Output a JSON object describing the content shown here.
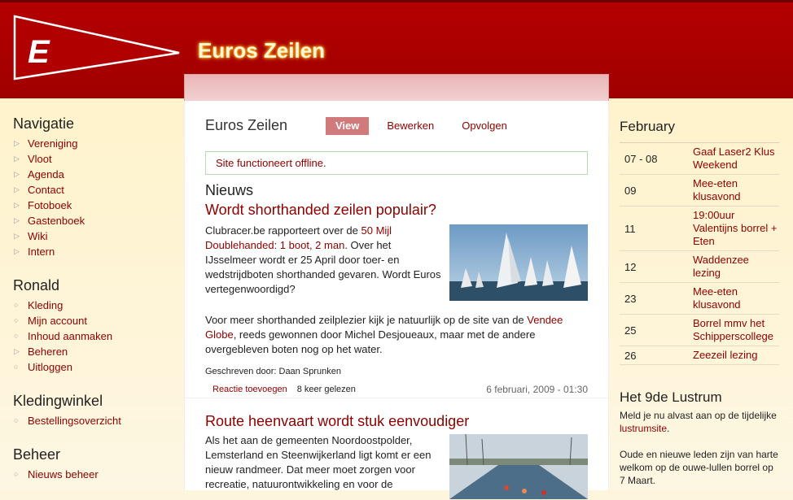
{
  "site": {
    "logo_letter": "E",
    "title": "Euros Zeilen",
    "colors": {
      "brand_red": "#a80000",
      "link": "#8b0000",
      "cream": "#fdf5dc"
    }
  },
  "left": {
    "menus": [
      {
        "heading": "Navigatie",
        "bullet": "triangle",
        "items": [
          "Vereniging",
          "Vloot",
          "Agenda",
          "Contact",
          "Fotoboek",
          "Gastenboek",
          "Wiki",
          "Intern"
        ]
      },
      {
        "heading": "Ronald",
        "bullet": "circle",
        "items": [
          "Kleding",
          "Mijn account",
          "Inhoud aanmaken",
          "Beheren",
          "Uitloggen"
        ]
      },
      {
        "heading": "Kledingwinkel",
        "bullet": "circle",
        "items": [
          "Bestellingsoverzicht"
        ]
      },
      {
        "heading": "Beheer",
        "bullet": "circle",
        "items": [
          "Nieuws beheer"
        ]
      }
    ]
  },
  "main": {
    "title": "Euros Zeilen",
    "tabs": [
      {
        "label": "View"
      },
      {
        "label": "Bewerken"
      },
      {
        "label": "Opvolgen"
      }
    ],
    "status": "Site functioneert offline.",
    "section_title": "Nieuws",
    "articles": [
      {
        "title": "Wordt shorthanded zeilen populair?",
        "p1_pre": "Clubracer.be rapporteert over de ",
        "p1_link": "50 Mijl Doublehanded: 1 boot, 2 man",
        "p1_post": ". Over het IJsselmeer wordt er 25 April door toer- en wedstrijdboten shorthanded gevaren. Wordt Euros vertegenwoordigd?",
        "p2_pre": "Voor meer shorthanded zeilplezier kijk je natuurlijk op de site van de ",
        "p2_link": "Vendee Globe",
        "p2_post": ", reeds gewonnen door Michel Desjoueaux, maar met de andere overgebleven boten nog op het water.",
        "author_label": "Geschreven door:",
        "author": "Daan Sprunken",
        "comment_link": "Reactie toevoegen",
        "reads": "8 keer gelezen",
        "date": "6 februari, 2009 - 01:30"
      },
      {
        "title": "Route heenvaart wordt stuk eenvoudiger",
        "p1": "Als het aan de gemeenten Noordoostpolder, Lemsterland en Steenwijkerland ligt komt er een nieuw randmeer. Dat meer moet zorgen voor recreatie, natuurontwikkeling en voor de"
      }
    ]
  },
  "right": {
    "calendar": {
      "month": "February",
      "events": [
        {
          "date": "07 - 08",
          "title": "Gaaf Laser2 Klus Weekend"
        },
        {
          "date": "09",
          "title": "Mee-eten klusavond"
        },
        {
          "date": "11",
          "title": "19:00uur Valentijns borrel + Eten"
        },
        {
          "date": "12",
          "title": "Waddenzee lezing"
        },
        {
          "date": "23",
          "title": "Mee-eten klusavond"
        },
        {
          "date": "25",
          "title": "Borrel mmv het Schipperscollege"
        },
        {
          "date": "26",
          "title": "Zeezeil lezing"
        }
      ]
    },
    "lustrum": {
      "heading": "Het 9de Lustrum",
      "p1_pre": "Meld je nu alvast aan op de tijdelijke ",
      "p1_link": "lustrumsite",
      "p1_post": ".",
      "p2": "Oude en nieuwe leden zijn van harte welkom op de ouwe-lullen borrel op 7 Maart."
    }
  }
}
